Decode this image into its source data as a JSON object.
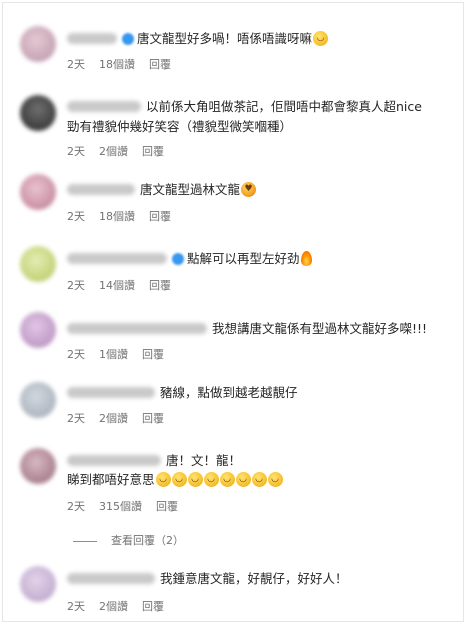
{
  "colors": {
    "text": "#262626",
    "muted": "#737373",
    "border": "#e6e6e6"
  },
  "comments": [
    {
      "text": "唐文龍型好多喎！唔係唔識呀嘛",
      "emojis": [
        "grinning-squinting"
      ],
      "time": "2天",
      "likes": "18個讚",
      "reply": "回覆"
    },
    {
      "text": "以前係大角咀做茶記，佢間唔中都會黎真人超nice",
      "text2": "勁有禮貌仲幾好笑容（禮貌型微笑嗰種）",
      "time": "2天",
      "likes": "2個讚",
      "reply": "回覆"
    },
    {
      "text": "唐文龍型過林文龍",
      "emojis": [
        "heart-eyes"
      ],
      "time": "2天",
      "likes": "18個讚",
      "reply": "回覆"
    },
    {
      "text": "點解可以再型左好劲",
      "emojis": [
        "fire"
      ],
      "time": "2天",
      "likes": "14個讚",
      "reply": "回覆"
    },
    {
      "text": "我想講唐文龍係有型過林文龍好多㗎!!!",
      "time": "2天",
      "likes": "1個讚",
      "reply": "回覆"
    },
    {
      "text": "豬線，點做到越老越靚仔",
      "time": "2天",
      "likes": "2個讚",
      "reply": "回覆"
    },
    {
      "text": "唐！文！龍！",
      "text2": "睇到都唔好意思",
      "emojis": [
        "grinning-squinting",
        "grinning-squinting",
        "grinning-squinting",
        "grinning-squinting",
        "grinning-squinting",
        "grinning-squinting",
        "grinning-squinting",
        "grinning-squinting"
      ],
      "time": "2天",
      "likes": "315個讚",
      "reply": "回覆",
      "view_replies": "查看回覆（2）"
    },
    {
      "text": "我鍾意唐文龍，好靚仔，好好人！",
      "time": "2天",
      "likes": "2個讚",
      "reply": "回覆"
    }
  ]
}
